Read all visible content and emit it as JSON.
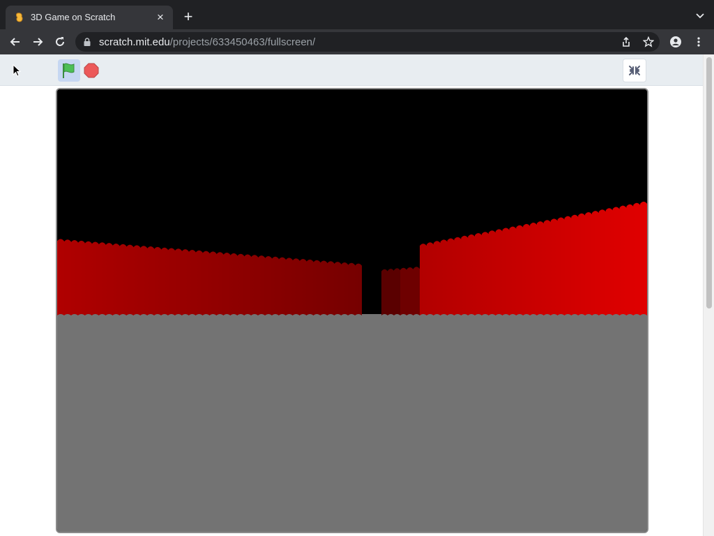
{
  "browser": {
    "tab_title": "3D Game on Scratch",
    "url_host": "scratch.mit.edu",
    "url_path": "/projects/633450463/fullscreen/"
  },
  "scratch": {
    "project_id": "633450463",
    "colors": {
      "sky": "#000000",
      "floor": "#737373",
      "wall_near": "#e00000",
      "wall_far": "#5a0000",
      "green_flag": "#4cbf56",
      "stop_sign": "#ec5959",
      "header_bg": "#e8edf1"
    }
  },
  "icons": {
    "favicon": "scratch-cat-icon",
    "close": "close-icon",
    "new_tab": "plus-icon",
    "tab_search": "chevron-down-icon",
    "back": "back-arrow-icon",
    "forward": "forward-arrow-icon",
    "reload": "reload-icon",
    "lock": "lock-icon",
    "share": "share-icon",
    "bookmark": "star-icon",
    "profile": "profile-icon",
    "menu": "kebab-menu-icon",
    "green_flag": "green-flag-icon",
    "stop": "stop-sign-icon",
    "exit_fullscreen": "exit-fullscreen-icon"
  }
}
